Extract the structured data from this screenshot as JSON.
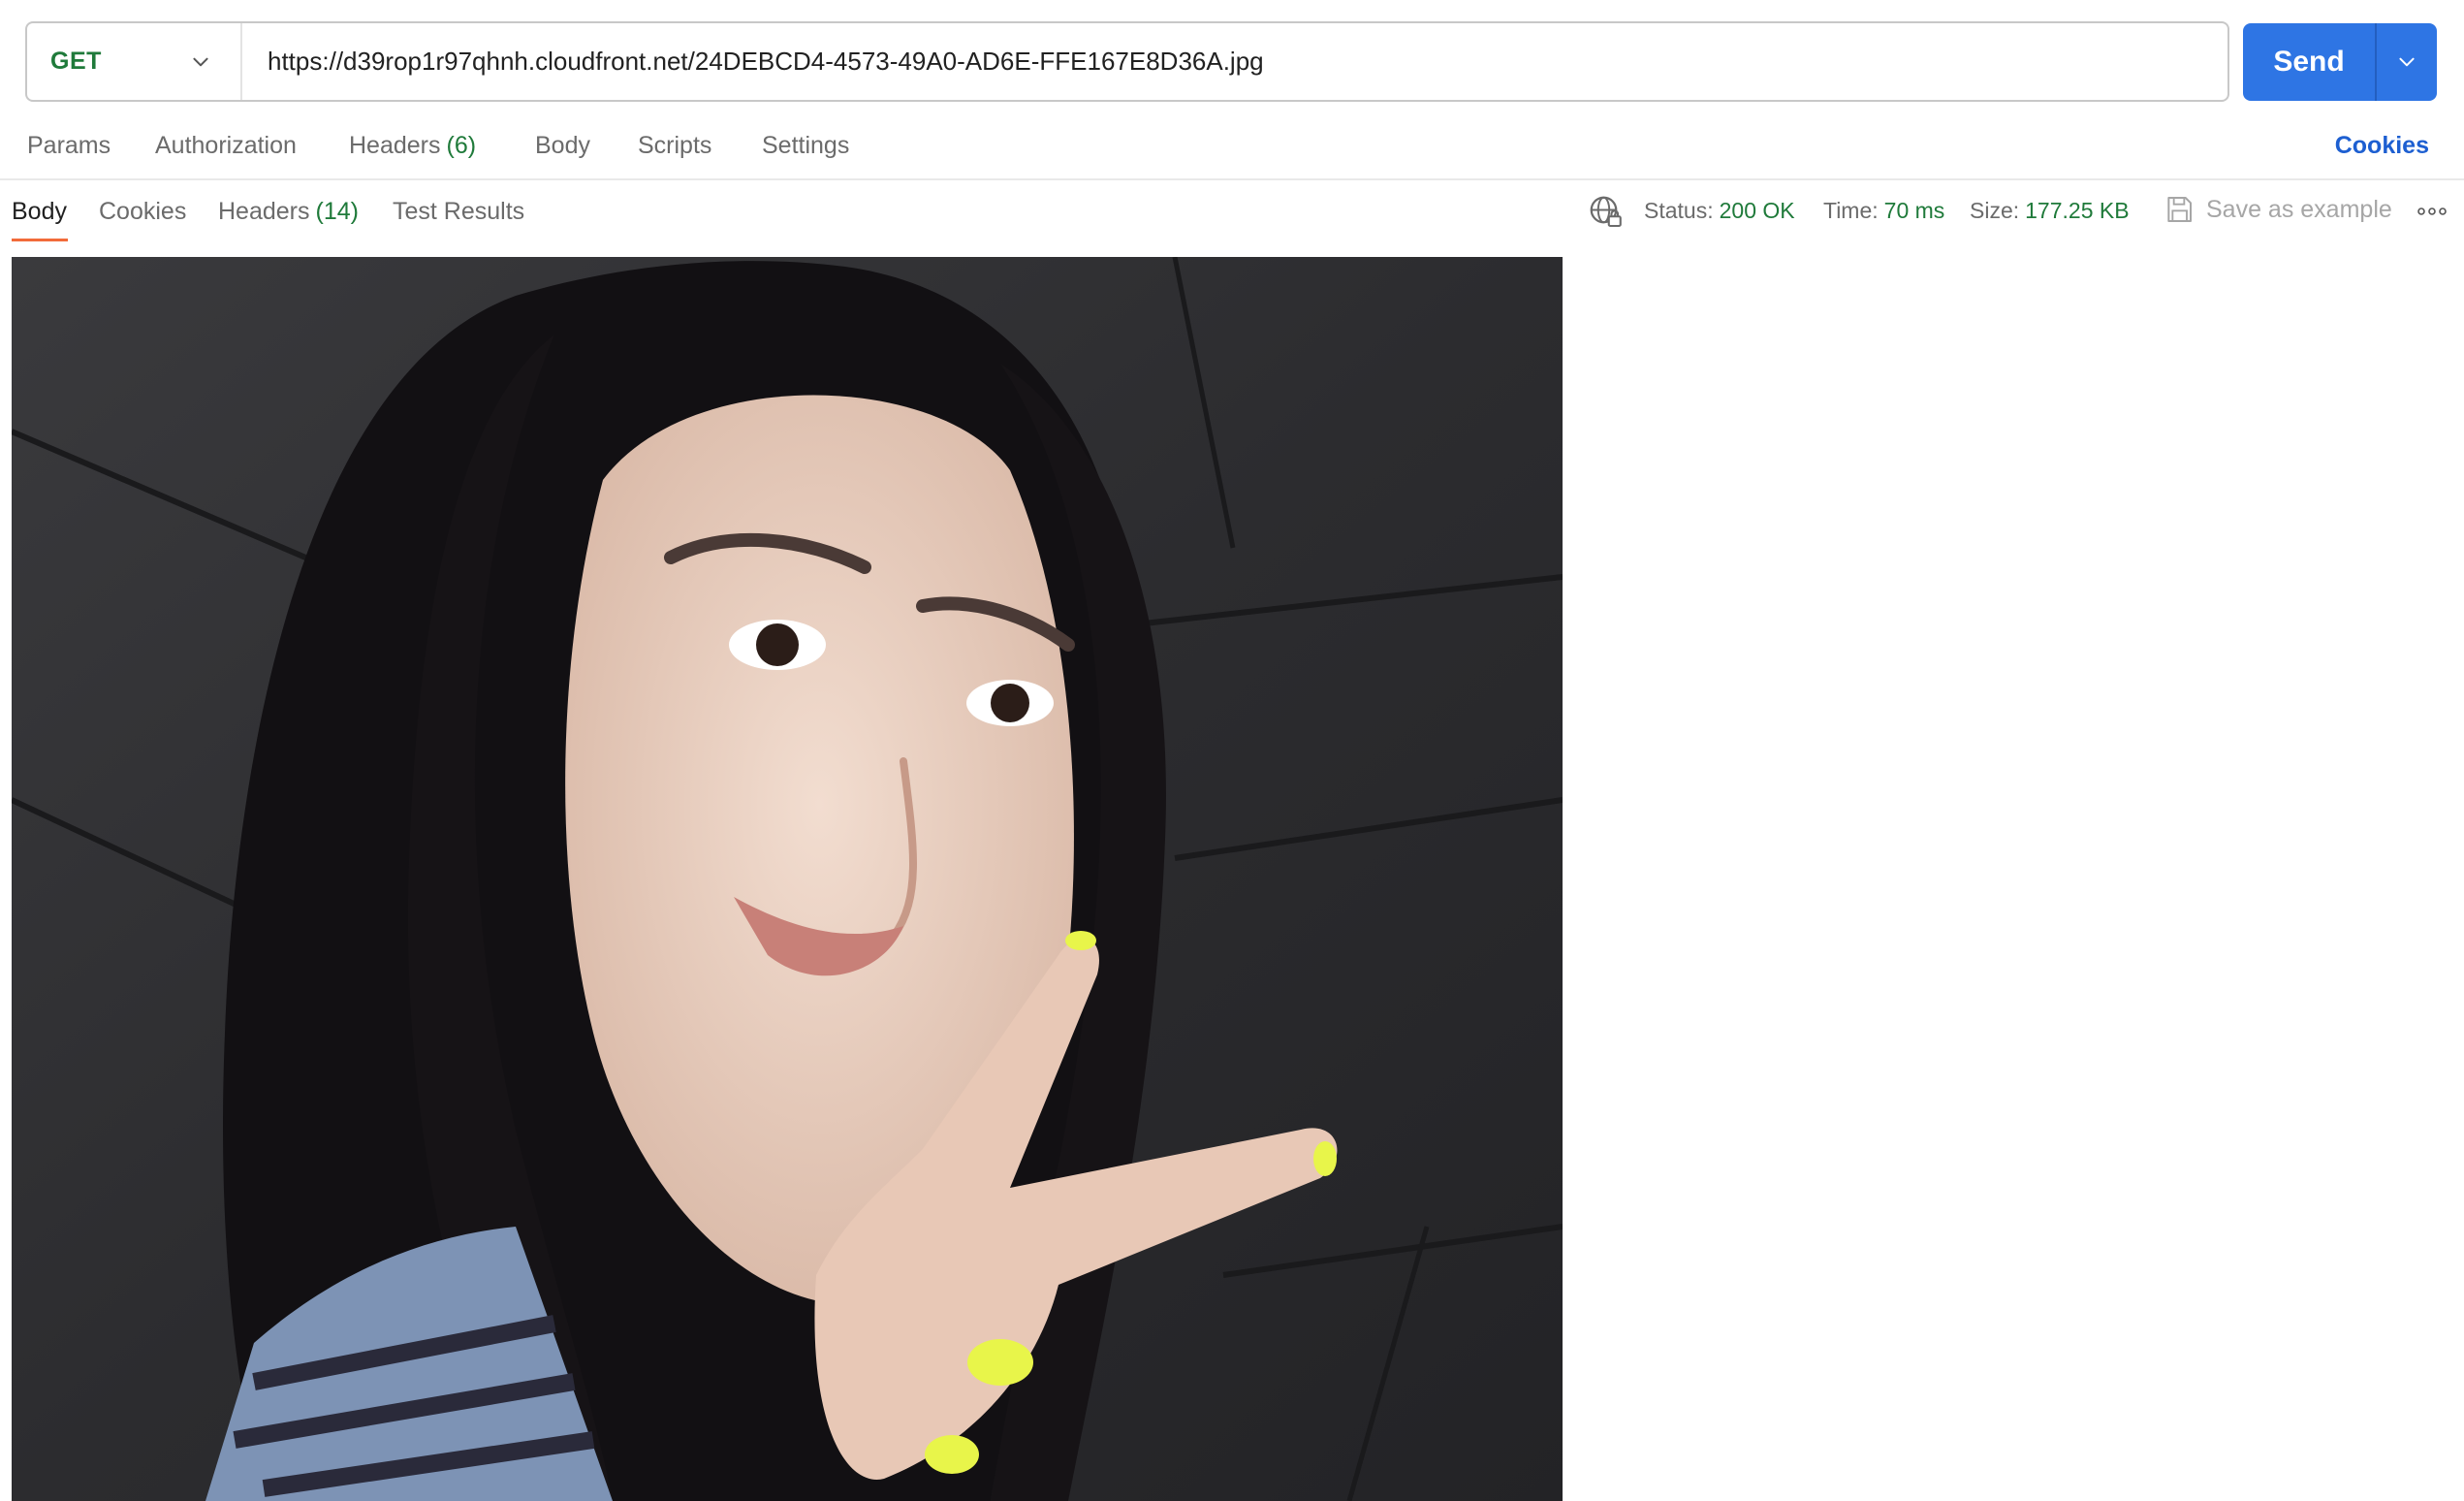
{
  "request": {
    "method": "GET",
    "url": "https://d39rop1r97qhnh.cloudfront.net/24DEBCD4-4573-49A0-AD6E-FFE167E8D36A.jpg",
    "send_label": "Send"
  },
  "request_tabs": {
    "params": "Params",
    "authorization": "Authorization",
    "headers": "Headers",
    "headers_count": "(6)",
    "body": "Body",
    "scripts": "Scripts",
    "settings": "Settings",
    "cookies": "Cookies"
  },
  "response_tabs": {
    "body": "Body",
    "cookies": "Cookies",
    "headers": "Headers",
    "headers_count": "(14)",
    "test_results": "Test Results"
  },
  "response_meta": {
    "status_label": "Status:",
    "status_value": "200 OK",
    "time_label": "Time:",
    "time_value": "70 ms",
    "size_label": "Size:",
    "size_value": "177.25 KB",
    "save_example": "Save as example"
  },
  "colors": {
    "accent": "#2e75e4",
    "success": "#1f7a3a",
    "active_tab_underline": "#f26b3a",
    "link": "#1d5fd1"
  },
  "icons": {
    "method_dropdown": "chevron-down-icon",
    "send_dropdown": "chevron-down-icon",
    "network": "globe-lock-icon",
    "save": "floppy-disk-icon",
    "more": "ellipsis-icon"
  }
}
